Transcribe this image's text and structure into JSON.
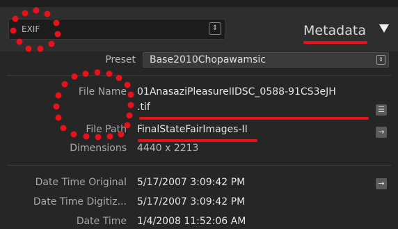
{
  "panel": {
    "view_select_label": "EXIF",
    "view_select_arrows": "⇕",
    "title": "Metadata"
  },
  "preset": {
    "label": "Preset",
    "value": "Base2010Chopawamsic",
    "arrows": "⇕"
  },
  "file_info": [
    {
      "label": "File Name",
      "value_line1": "01AnasaziPleasureIIDSC_0588-91CS3eJH",
      "value_line2": ".tif",
      "button_icon": "list-icon"
    },
    {
      "label": "File Path",
      "value": "FinalStateFairImages-II",
      "button_icon": "go-to-arrow-icon"
    },
    {
      "label": "Dimensions",
      "value": "4440 x 2213"
    }
  ],
  "date_info": [
    {
      "label": "Date Time Original",
      "value": "5/17/2007 3:09:42 PM",
      "button_icon": "go-to-arrow-icon"
    },
    {
      "label": "Date Time Digitiz...",
      "value": "5/17/2007 3:09:42 PM"
    },
    {
      "label": "Date Time",
      "value": "1/4/2008 11:52:06 AM"
    }
  ],
  "annotation_color": "#e8121a"
}
